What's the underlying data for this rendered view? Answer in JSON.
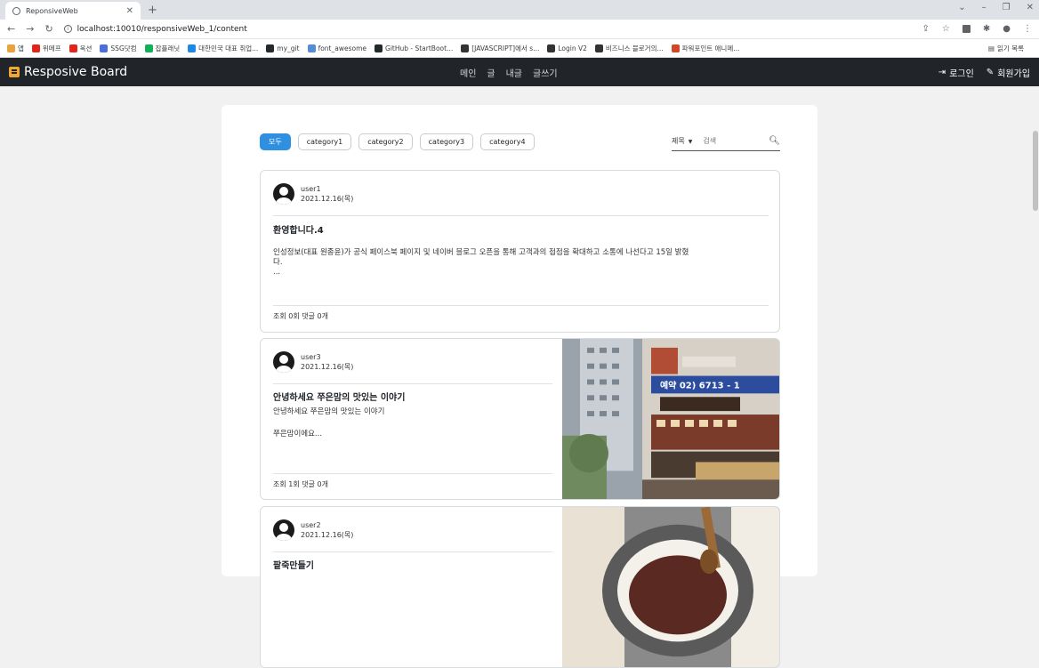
{
  "browser": {
    "tab_title": "ReponsiveWeb",
    "url": "localhost:10010/responsiveWeb_1/content",
    "bookmarks": [
      {
        "label": "앱",
        "color": "#e8a33d"
      },
      {
        "label": "위메프",
        "color": "#e1251b"
      },
      {
        "label": "옥션",
        "color": "#e1251b"
      },
      {
        "label": "SSG닷컴",
        "color": "#4a6fd8"
      },
      {
        "label": "잡플래닛",
        "color": "#13b05b"
      },
      {
        "label": "대한민국 대표 취업...",
        "color": "#1e88e5"
      },
      {
        "label": "my_git",
        "color": "#24292e"
      },
      {
        "label": "font_awesome",
        "color": "#538dd7"
      },
      {
        "label": "GitHub - StartBoot...",
        "color": "#24292e"
      },
      {
        "label": "[JAVASCRIPT]에서 s...",
        "color": "#333333"
      },
      {
        "label": "Login V2",
        "color": "#333333"
      },
      {
        "label": "비즈니스 블로거의...",
        "color": "#333333"
      },
      {
        "label": "파워포인트 애니메...",
        "color": "#d24726"
      }
    ],
    "reading_list": "읽기 목록"
  },
  "navbar": {
    "brand": "Resposive Board",
    "menu": [
      "메인",
      "글",
      "내글",
      "글쓰기"
    ],
    "login": "로그인",
    "signup": "회원가입"
  },
  "filters": {
    "items": [
      "모두",
      "category1",
      "category2",
      "category3",
      "category4"
    ]
  },
  "search": {
    "select_value": "제목",
    "placeholder": "검색"
  },
  "posts": [
    {
      "user": "user1",
      "date": "2021.12.16(목)",
      "title": "환영합니다.4",
      "body_line1": "인성정보(대표 원종윤)가 공식 페이스북 페이지 및 네이버 블로그 오픈을 통해 고객과의 접점을 확대하고 소통에 나선다고 15일 밝혔",
      "body_line2": "다.",
      "body_line3": "...",
      "stats": "조회 0회  댓글 0개"
    },
    {
      "user": "user3",
      "date": "2021.12.16(목)",
      "title": "안녕하세요 쭈은맘의 맛있는 이야기",
      "body_line1": "안녕하세요 쭈은맘의 맛있는 이야기",
      "body_line2": "쭈은맘이에요...",
      "stats": "조회 1회  댓글 0개",
      "sign_text": "예약 02) 6713 - 1"
    },
    {
      "user": "user2",
      "date": "2021.12.16(목)",
      "title": "팥죽만들기"
    }
  ]
}
